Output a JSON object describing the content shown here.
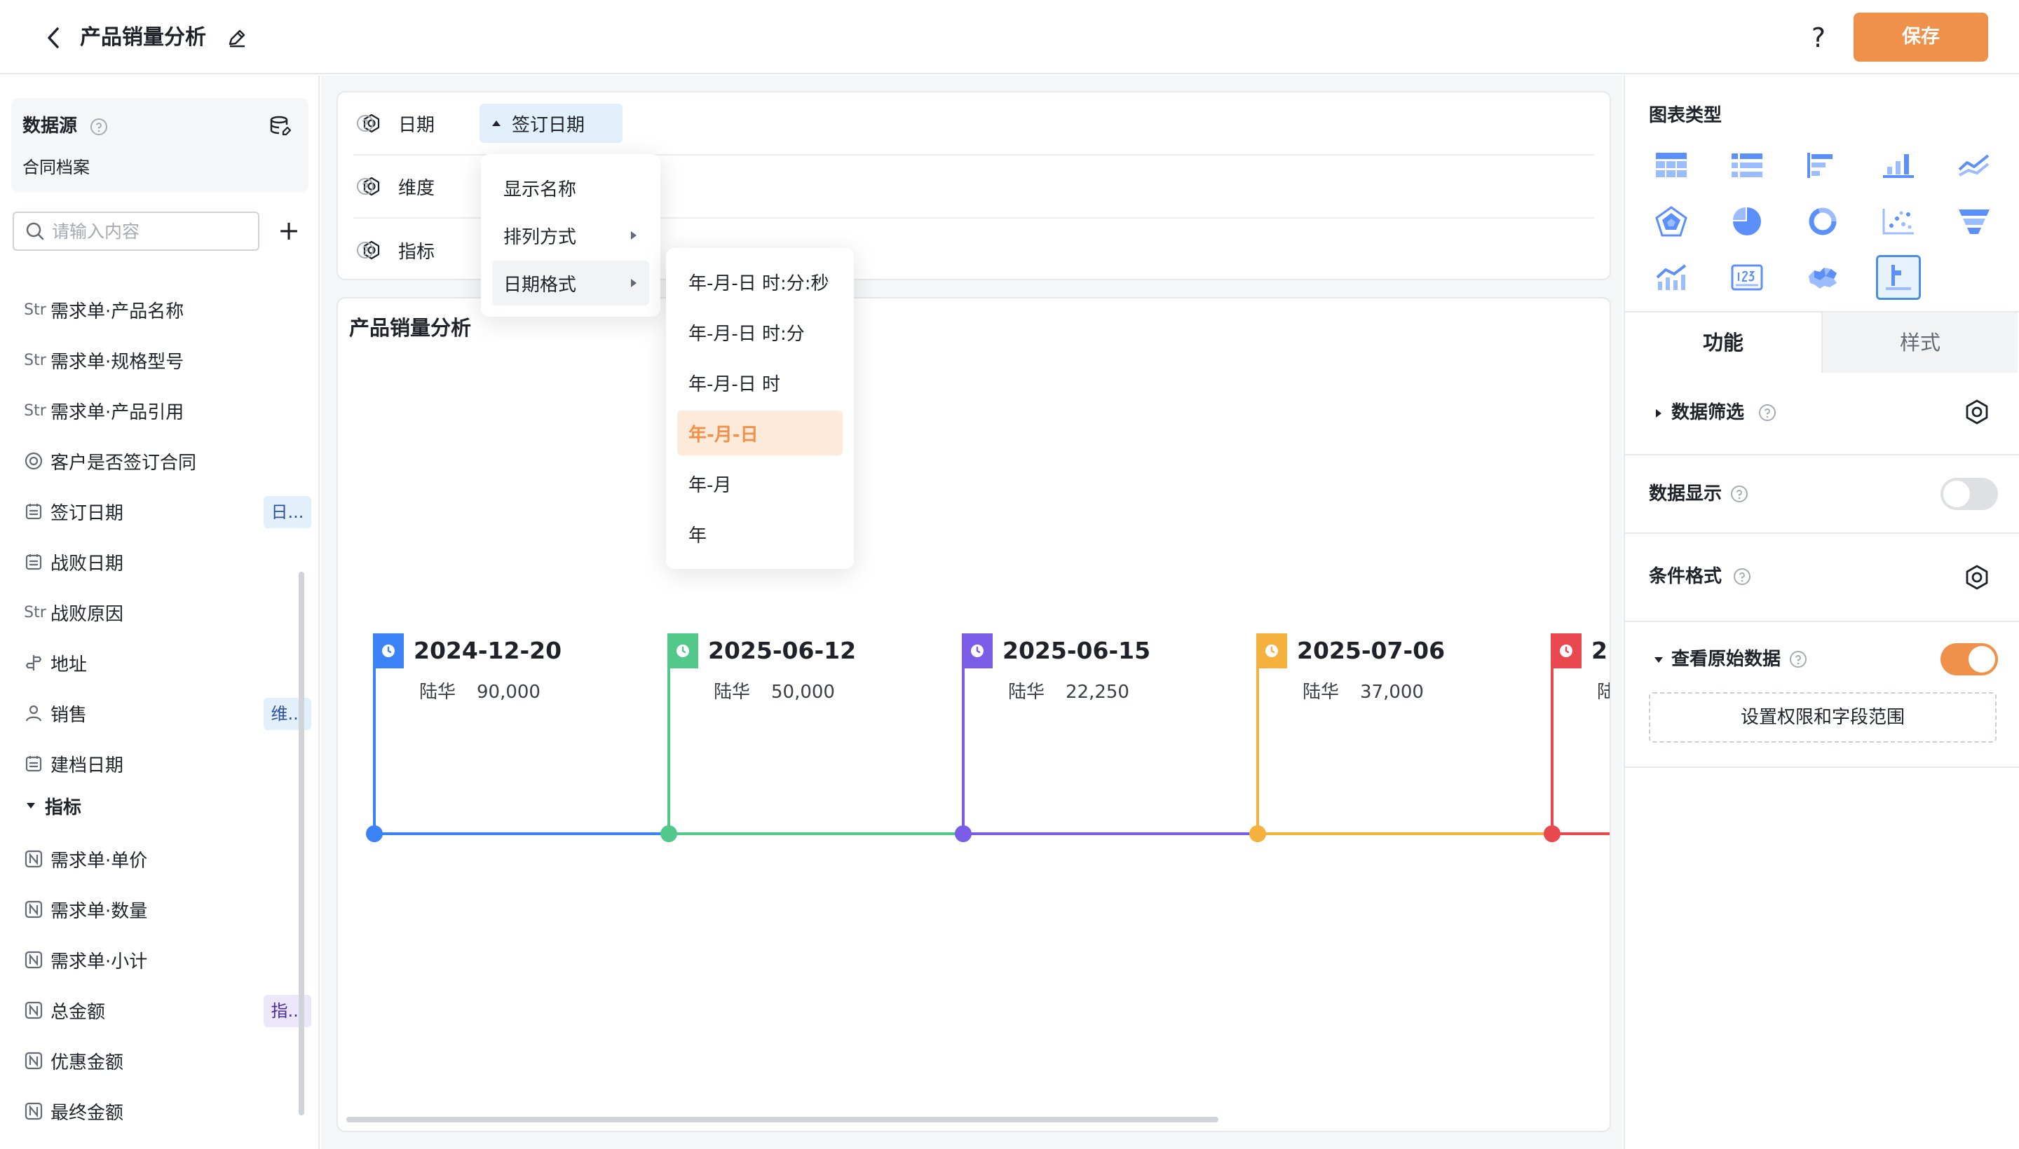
{
  "header": {
    "title": "产品销量分析",
    "help_label": "?",
    "save_label": "保存"
  },
  "datasource": {
    "title": "数据源",
    "name": "合同档案",
    "search_placeholder": "请输入内容",
    "add_label": "+"
  },
  "fields": [
    {
      "type": "Str",
      "label": "需求单·产品名称",
      "tag": ""
    },
    {
      "type": "Str",
      "label": "需求单·规格型号",
      "tag": ""
    },
    {
      "type": "Str",
      "label": "需求单·产品引用",
      "tag": ""
    },
    {
      "type": "radio",
      "label": "客户是否签订合同",
      "tag": ""
    },
    {
      "type": "date",
      "label": "签订日期",
      "tag": "日..."
    },
    {
      "type": "date",
      "label": "战败日期",
      "tag": ""
    },
    {
      "type": "Str",
      "label": "战败原因",
      "tag": ""
    },
    {
      "type": "address",
      "label": "地址",
      "tag": ""
    },
    {
      "type": "user",
      "label": "销售",
      "tag": "维..."
    },
    {
      "type": "date",
      "label": "建档日期",
      "tag": ""
    }
  ],
  "metrics_group": {
    "title": "指标",
    "items": [
      {
        "label": "需求单·单价",
        "tag": ""
      },
      {
        "label": "需求单·数量",
        "tag": ""
      },
      {
        "label": "需求单·小计",
        "tag": ""
      },
      {
        "label": "总金额",
        "tag": "指..."
      },
      {
        "label": "优惠金额",
        "tag": ""
      },
      {
        "label": "最终金额",
        "tag": ""
      }
    ]
  },
  "config": {
    "rows": [
      {
        "label": "日期"
      },
      {
        "label": "维度"
      },
      {
        "label": "指标"
      }
    ],
    "date_chip": "签订日期"
  },
  "menu": {
    "items": [
      "显示名称",
      "排列方式",
      "日期格式"
    ],
    "submenu": [
      "年-月-日 时:分:秒",
      "年-月-日 时:分",
      "年-月-日 时",
      "年-月-日",
      "年-月",
      "年"
    ],
    "selected_format": "年-月-日"
  },
  "chart": {
    "title": "产品销量分析",
    "items": [
      {
        "date": "2024-12-20",
        "name": "陆华",
        "value": "90,000",
        "color": "#3b82f6"
      },
      {
        "date": "2025-06-12",
        "name": "陆华",
        "value": "50,000",
        "color": "#52c98a"
      },
      {
        "date": "2025-06-15",
        "name": "陆华",
        "value": "22,250",
        "color": "#7b5ce6"
      },
      {
        "date": "2025-07-06",
        "name": "陆华",
        "value": "37,000",
        "color": "#f4b13e"
      },
      {
        "date": "2",
        "name": "陆",
        "value": "",
        "color": "#e8484e"
      }
    ]
  },
  "right_panel": {
    "chart_type_title": "图表类型",
    "chart_types": [
      "table-icon",
      "list-icon",
      "bar-horizontal-icon",
      "bar-vertical-icon",
      "line-icon",
      "radar-icon",
      "pie-icon",
      "donut-icon",
      "scatter-icon",
      "funnel-icon",
      "combo-chart-icon",
      "number-card-icon",
      "map-icon",
      "timeline-icon"
    ],
    "tabs": [
      "功能",
      "样式"
    ],
    "data_filter": "数据筛选",
    "data_display": "数据显示",
    "conditional_format": "条件格式",
    "view_raw": "查看原始数据",
    "permission_button": "设置权限和字段范围"
  },
  "colors": {
    "accent": "#f0914b",
    "chip_bg": "#e1f0fb"
  }
}
